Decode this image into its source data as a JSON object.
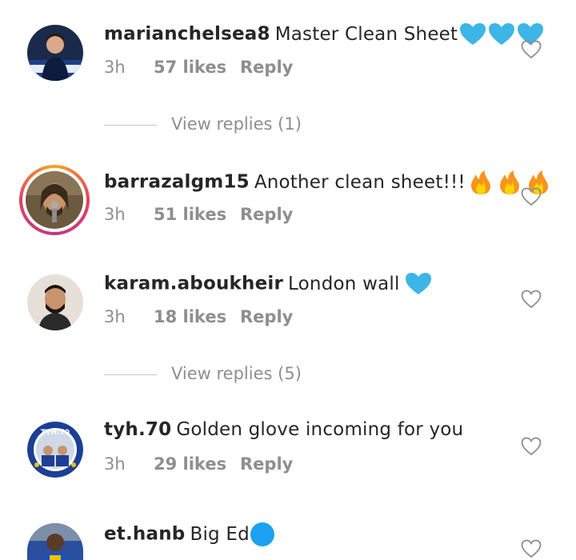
{
  "comments": [
    {
      "username": "marianchelsea8",
      "text": "Master Clean Sheet",
      "emoji": [
        "blue-heart",
        "blue-heart",
        "blue-heart"
      ],
      "time": "3h",
      "likes": "57 likes",
      "reply": "Reply",
      "view_replies": "View replies (1)"
    },
    {
      "username": "barrazalgm15",
      "text": "Another clean sheet!!!",
      "emoji": [
        "fire",
        "fire",
        "fire"
      ],
      "time": "3h",
      "likes": "51 likes",
      "reply": "Reply"
    },
    {
      "username": "karam.aboukheir",
      "text": "London wall",
      "emoji": [
        "blue-heart"
      ],
      "time": "3h",
      "likes": "18 likes",
      "reply": "Reply",
      "view_replies": "View replies (5)"
    },
    {
      "username": "tyh.70",
      "text": "Golden glove incoming for you",
      "time": "3h",
      "likes": "29 likes",
      "reply": "Reply"
    },
    {
      "username": "et.hanb",
      "text": "Big Ed",
      "emoji": [
        "blue-circle"
      ]
    }
  ],
  "colors": {
    "text": "#262626",
    "meta": "#8e8e8e",
    "blue_heart": "#3db5e6",
    "fire_outer": "#f7941d",
    "fire_inner": "#ffd200",
    "blue_circle": "#1da1f2"
  }
}
